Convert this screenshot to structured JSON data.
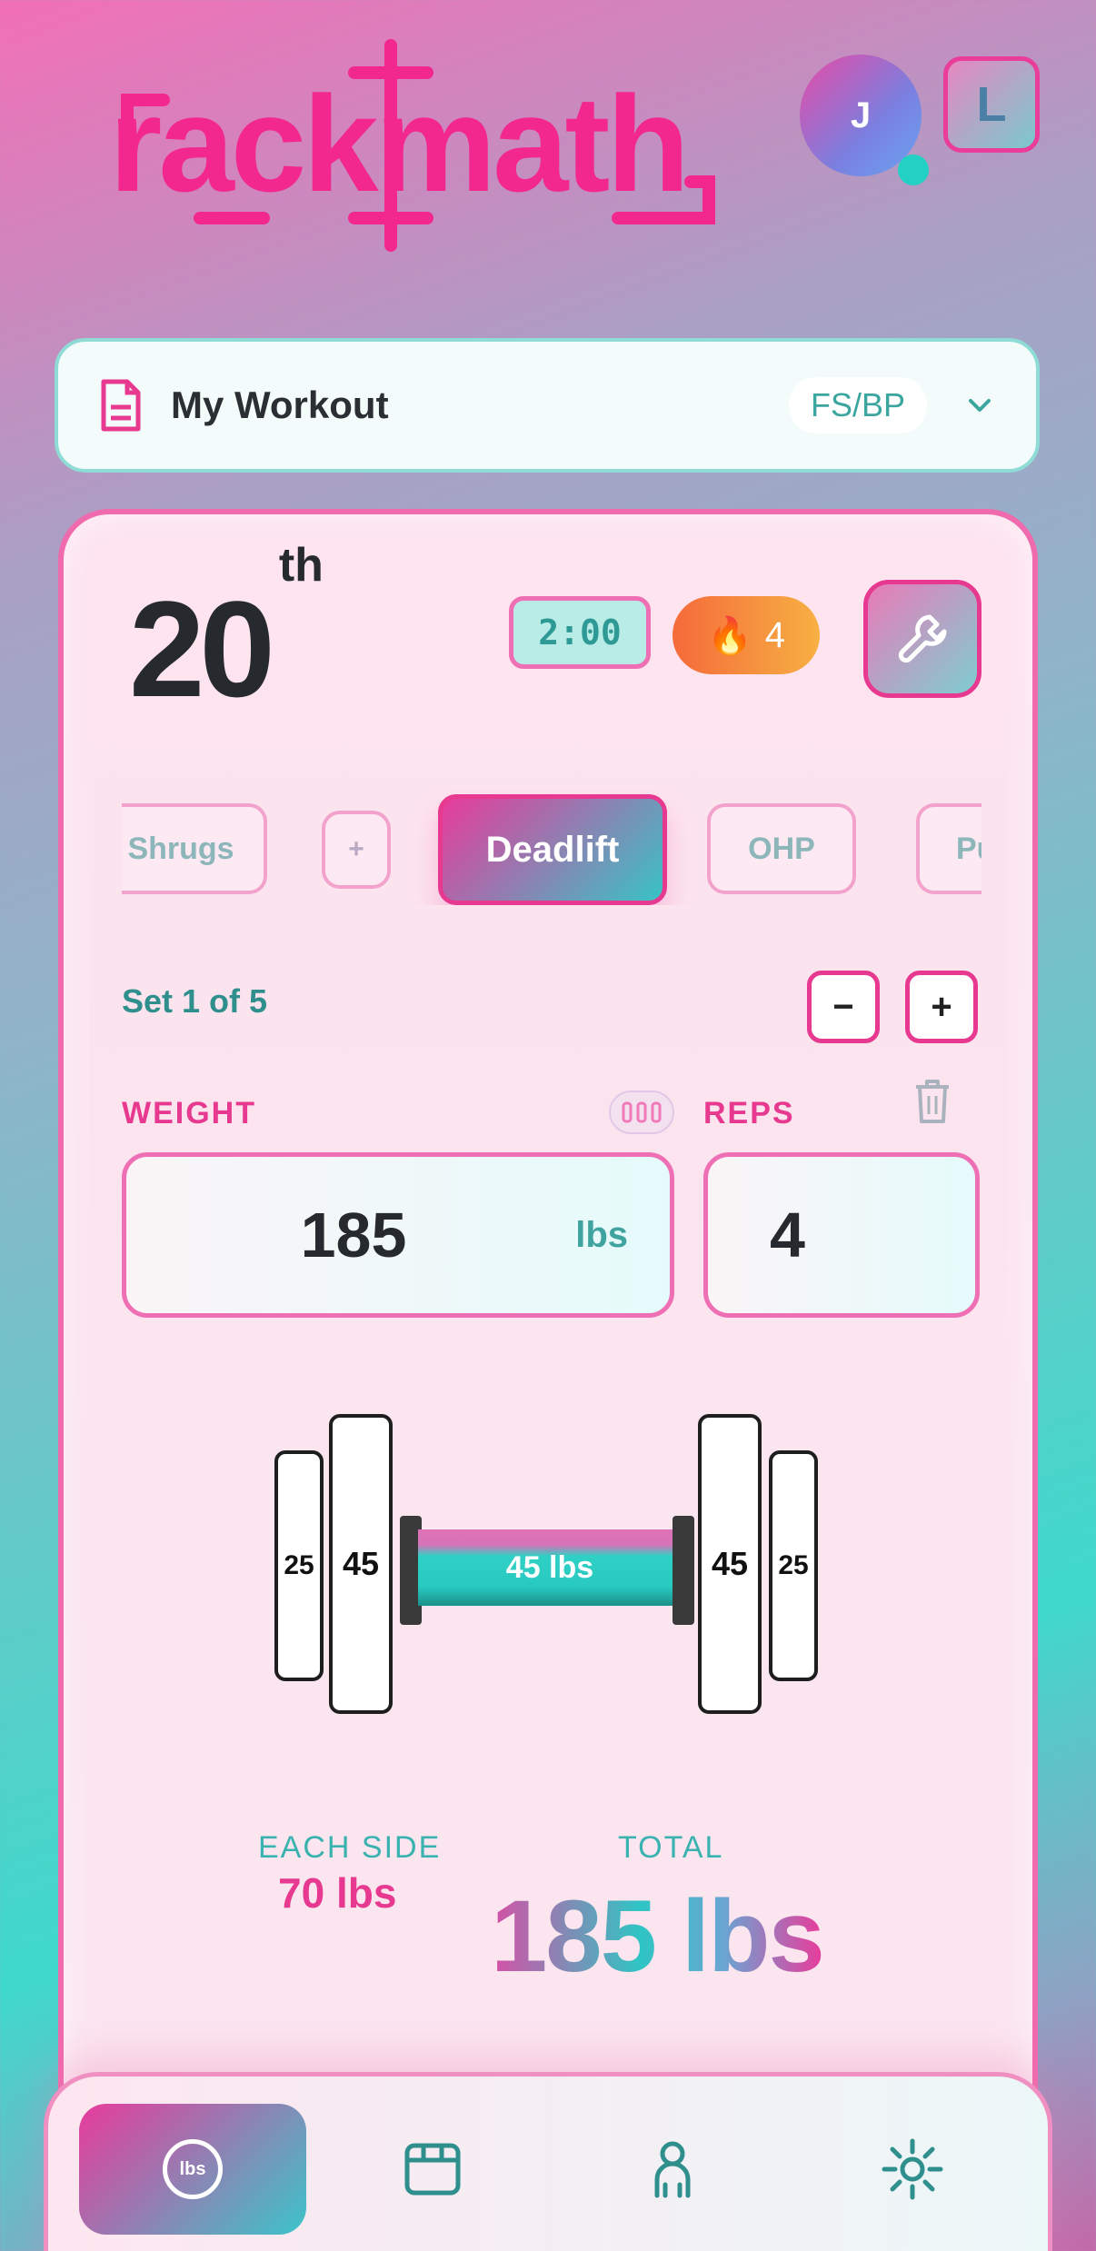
{
  "app": {
    "name": "rackmath"
  },
  "header": {
    "avatar_initial": "J",
    "lang_badge": "L"
  },
  "workout": {
    "title": "My Workout",
    "badge": "FS/BP"
  },
  "session": {
    "day_number": "20",
    "day_suffix": "th",
    "timer": "2:00",
    "streak": "4"
  },
  "exercises": {
    "items": [
      "Shrugs",
      "+",
      "Deadlift",
      "OHP",
      "Pu"
    ],
    "selected": "Deadlift"
  },
  "set": {
    "label": "Set 1 of 5",
    "minus": "−",
    "plus": "+"
  },
  "weight": {
    "label": "WEIGHT",
    "value": "185",
    "unit": "lbs"
  },
  "reps": {
    "label": "REPS",
    "value": "4"
  },
  "barbell": {
    "bar_label": "45 lbs",
    "left_plates": [
      "25",
      "45"
    ],
    "right_plates": [
      "45",
      "25"
    ]
  },
  "totals": {
    "each_side_label": "EACH SIDE",
    "each_side_value": "70 lbs",
    "total_label": "TOTAL",
    "total_value": "185 lbs"
  },
  "nav": {
    "calc_label": "lbs",
    "items": [
      "calculator",
      "calendar",
      "profile",
      "settings"
    ]
  },
  "colors": {
    "accent_pink": "#e6398f",
    "accent_teal": "#2fc5c4"
  }
}
